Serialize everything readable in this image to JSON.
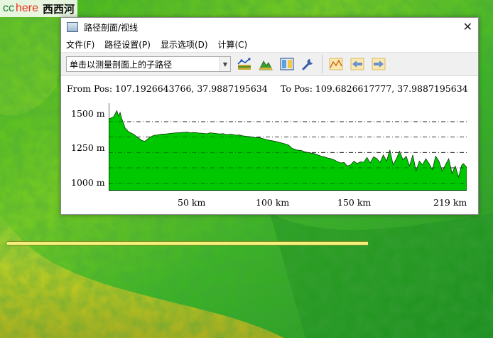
{
  "logo": {
    "part1": "cc",
    "part2": "here",
    "part3": "西西河"
  },
  "window": {
    "title": "路径剖面/视线",
    "close_symbol": "✕"
  },
  "menu": [
    "文件(F)",
    "路径设置(P)",
    "显示选项(D)",
    "计算(C)"
  ],
  "toolbar": {
    "combo_value": "单击以测量剖面上的子路径",
    "buttons": [
      "profile-settings-icon",
      "terrain-icon",
      "split-view-icon",
      "wrench-icon",
      "profile-line-icon",
      "step-back-icon",
      "step-forward-icon"
    ]
  },
  "profile": {
    "from_label": "From Pos:",
    "from_value": "107.1926643766, 37.9887195634",
    "to_label": "To Pos:",
    "to_value": "109.6826617777, 37.9887195634",
    "y_ticks": [
      "1500 m",
      "1250 m",
      "1000 m"
    ],
    "x_ticks": [
      "50 km",
      "100 km",
      "150 km",
      "219 km"
    ]
  },
  "colors": {
    "profile_fill": "#00c800",
    "window_bg": "#ffffff",
    "toolbar_bg": "#f0f0f0"
  },
  "chart_data": {
    "type": "area",
    "xlabel": "",
    "ylabel": "",
    "xlim": [
      0,
      219
    ],
    "ylim": [
      940,
      1650
    ],
    "gridlines_y": [
      1000,
      1125,
      1250,
      1375,
      1500
    ],
    "x": [
      0,
      3,
      5,
      6,
      7,
      8,
      9,
      10,
      12,
      15,
      18,
      20,
      22,
      24,
      26,
      28,
      30,
      32,
      35,
      38,
      40,
      42,
      45,
      48,
      50,
      52,
      55,
      58,
      60,
      62,
      65,
      68,
      70,
      72,
      75,
      78,
      80,
      82,
      85,
      88,
      90,
      92,
      95,
      98,
      100,
      102,
      105,
      108,
      110,
      112,
      115,
      118,
      120,
      122,
      124,
      126,
      128,
      130,
      132,
      134,
      136,
      138,
      140,
      142,
      144,
      146,
      148,
      150,
      152,
      154,
      156,
      158,
      160,
      162,
      164,
      166,
      168,
      170,
      172,
      174,
      176,
      178,
      180,
      182,
      184,
      186,
      188,
      190,
      192,
      194,
      196,
      198,
      200,
      202,
      204,
      206,
      208,
      210,
      212,
      214,
      216,
      217,
      219
    ],
    "y": [
      1520,
      1540,
      1590,
      1545,
      1575,
      1525,
      1490,
      1450,
      1420,
      1400,
      1370,
      1350,
      1340,
      1360,
      1380,
      1390,
      1392,
      1398,
      1400,
      1405,
      1408,
      1410,
      1412,
      1415,
      1410,
      1412,
      1408,
      1405,
      1402,
      1410,
      1405,
      1400,
      1403,
      1395,
      1398,
      1390,
      1392,
      1385,
      1380,
      1376,
      1370,
      1372,
      1360,
      1350,
      1345,
      1340,
      1330,
      1320,
      1310,
      1285,
      1270,
      1265,
      1255,
      1250,
      1245,
      1240,
      1230,
      1220,
      1215,
      1205,
      1200,
      1190,
      1175,
      1165,
      1170,
      1140,
      1150,
      1180,
      1160,
      1175,
      1170,
      1210,
      1165,
      1215,
      1200,
      1170,
      1230,
      1180,
      1270,
      1150,
      1200,
      1260,
      1190,
      1220,
      1140,
      1230,
      1100,
      1180,
      1150,
      1200,
      1160,
      1110,
      1220,
      1180,
      1100,
      1150,
      1200,
      1080,
      1140,
      1050,
      1150,
      1160,
      1130
    ]
  }
}
